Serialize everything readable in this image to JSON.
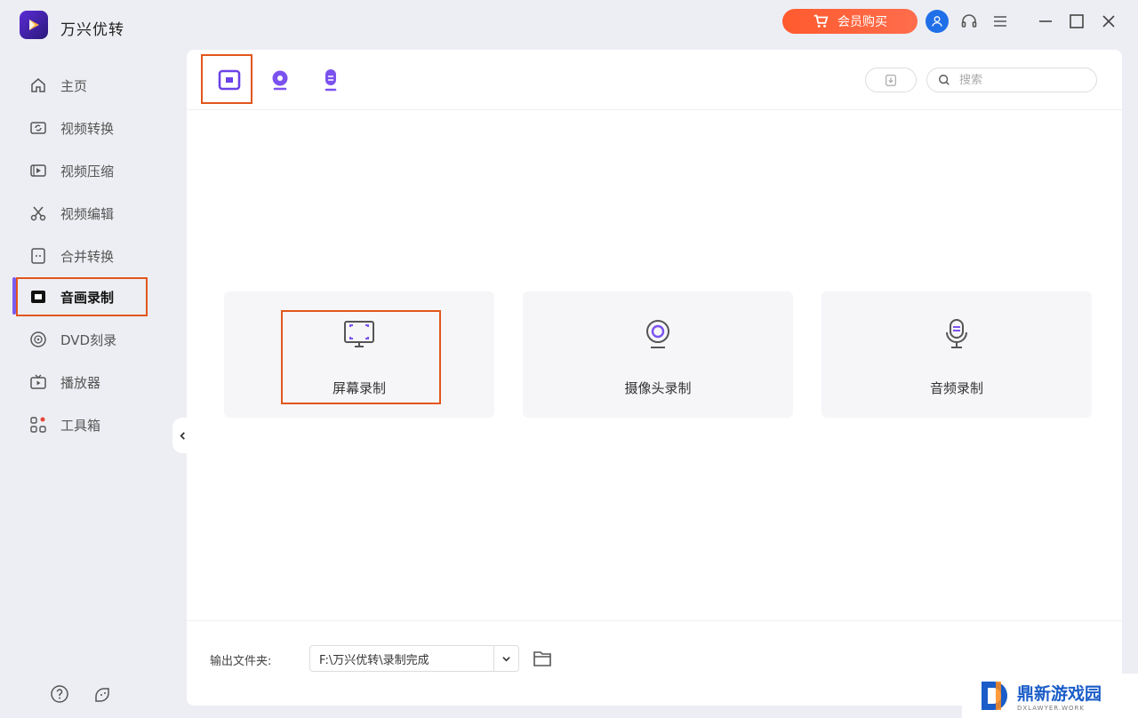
{
  "app": {
    "title": "万兴优转"
  },
  "titlebar": {
    "vip_label": "会员购买"
  },
  "sidebar": {
    "items": [
      {
        "label": "主页",
        "icon": "home-icon"
      },
      {
        "label": "视频转换",
        "icon": "video-convert-icon"
      },
      {
        "label": "视频压缩",
        "icon": "video-compress-icon"
      },
      {
        "label": "视频编辑",
        "icon": "scissors-icon"
      },
      {
        "label": "合并转换",
        "icon": "merge-icon"
      },
      {
        "label": "音画录制",
        "icon": "record-icon",
        "active": true
      },
      {
        "label": "DVD刻录",
        "icon": "dvd-icon"
      },
      {
        "label": "播放器",
        "icon": "player-icon"
      },
      {
        "label": "工具箱",
        "icon": "toolbox-icon"
      }
    ]
  },
  "toolbar": {
    "tabs": [
      "screen-record-tab",
      "webcam-record-tab",
      "audio-record-tab"
    ],
    "search_placeholder": "搜索"
  },
  "cards": [
    {
      "label": "屏幕录制",
      "icon": "monitor-icon"
    },
    {
      "label": "摄像头录制",
      "icon": "webcam-icon"
    },
    {
      "label": "音频录制",
      "icon": "microphone-icon"
    }
  ],
  "footer": {
    "output_label": "输出文件夹:",
    "output_path": "F:\\万兴优转\\录制完成"
  },
  "watermark": {
    "name": "鼎新游戏园",
    "domain": "DXLAWYER.WORK"
  },
  "colors": {
    "accent": "#7b5cf0",
    "highlight": "#e2561c",
    "vip": "#ff5a2e"
  }
}
